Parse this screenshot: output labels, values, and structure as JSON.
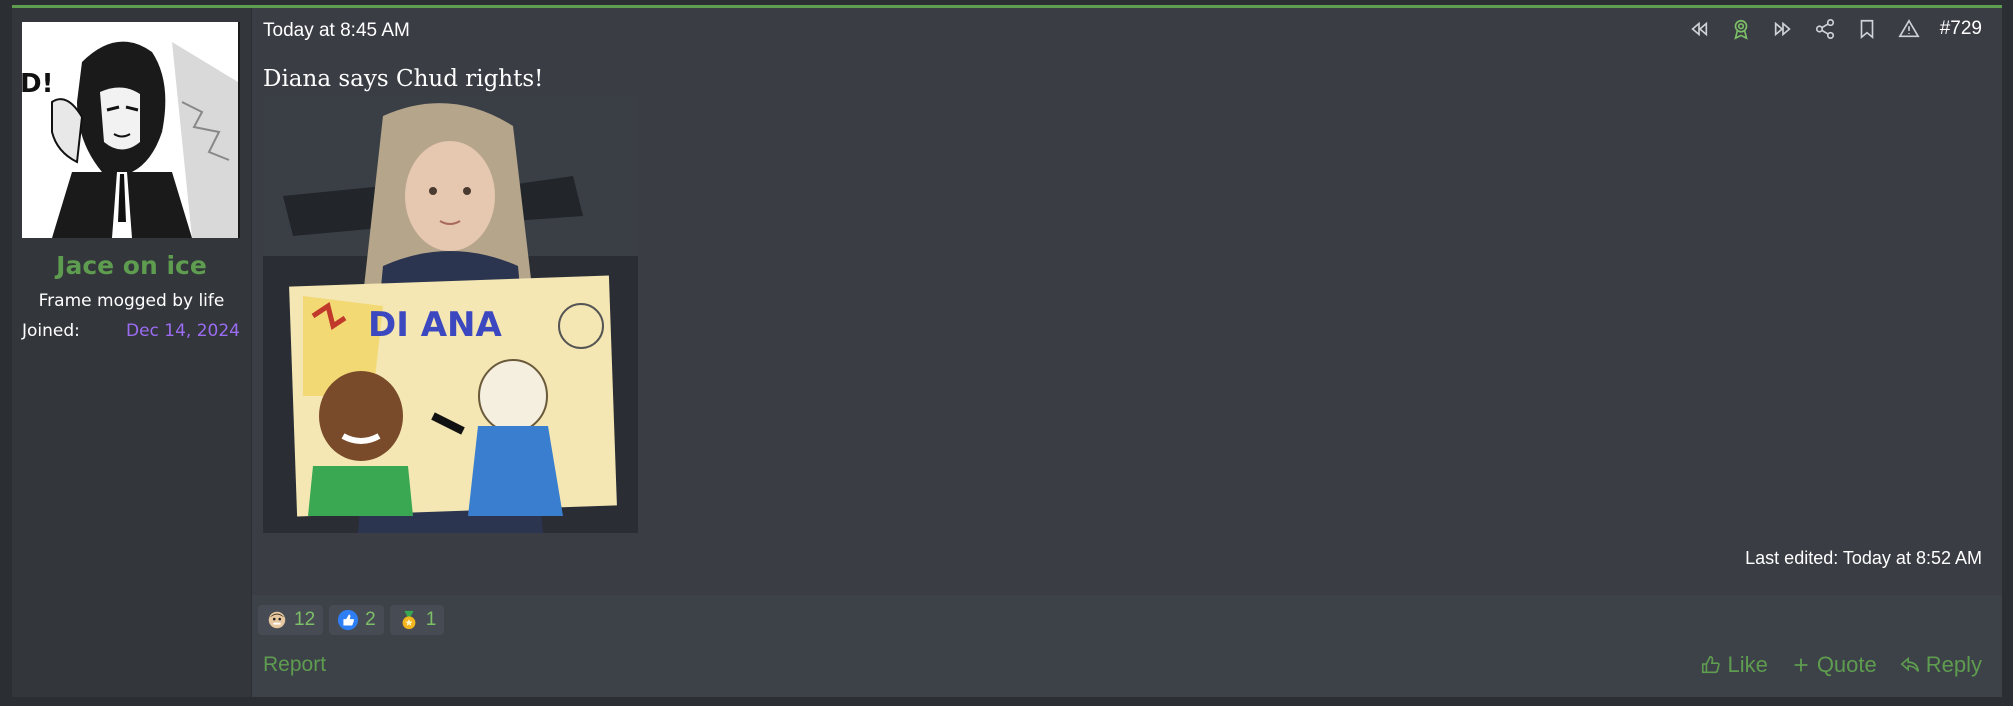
{
  "user": {
    "name": "Jace on ice",
    "title": "Frame mogged by life",
    "joined_label": "Joined:",
    "joined_value": "Dec 14, 2024",
    "avatar_text": "D!"
  },
  "post": {
    "date": "Today at 8:45 AM",
    "number": "#729",
    "message": "Diana says Chud rights!",
    "last_edited": "Last edited: Today at 8:52 AM",
    "image_sign_text": "DI ANA"
  },
  "toolbar": {
    "icons": [
      "rewind-icon",
      "award-icon",
      "fast-forward-icon",
      "share-icon",
      "bookmark-icon",
      "warning-icon"
    ]
  },
  "reactions": [
    {
      "icon": "face-emoji-icon",
      "count": "12"
    },
    {
      "icon": "thumbs-up-icon",
      "count": "2"
    },
    {
      "icon": "medal-icon",
      "count": "1"
    }
  ],
  "footer": {
    "report": "Report",
    "like": "Like",
    "quote": "Quote",
    "reply": "Reply"
  },
  "colors": {
    "accent": "#5e9c4f",
    "joined_date": "#9b6cf2",
    "background": "#3a3d44"
  }
}
